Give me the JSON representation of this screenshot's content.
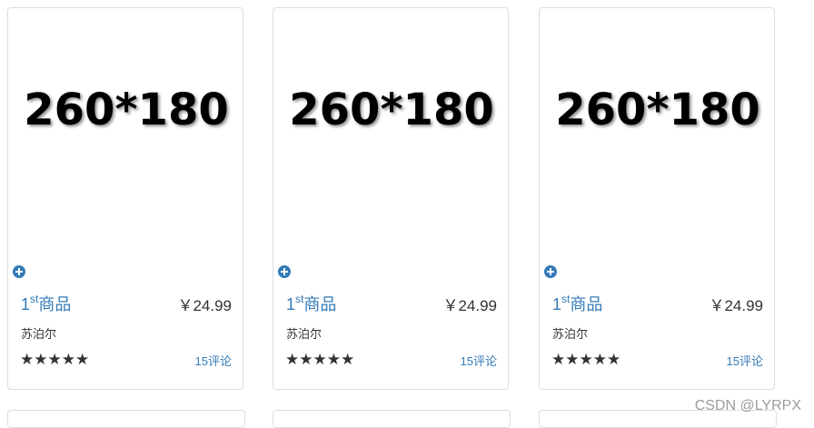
{
  "products": [
    {
      "image_text": "260*180",
      "rank": "1",
      "rank_suffix": "st",
      "name": "商品",
      "price": "￥24.99",
      "seller": "苏泊尔",
      "stars": "★★★★★",
      "reviews": "15评论"
    },
    {
      "image_text": "260*180",
      "rank": "1",
      "rank_suffix": "st",
      "name": "商品",
      "price": "￥24.99",
      "seller": "苏泊尔",
      "stars": "★★★★★",
      "reviews": "15评论"
    },
    {
      "image_text": "260*180",
      "rank": "1",
      "rank_suffix": "st",
      "name": "商品",
      "price": "￥24.99",
      "seller": "苏泊尔",
      "stars": "★★★★★",
      "reviews": "15评论"
    }
  ],
  "watermark": "CSDN @LYRPX",
  "icons": {
    "add": "plus-circle-icon"
  },
  "colors": {
    "link": "#337ab7",
    "border": "#dddddd",
    "text": "#333333"
  }
}
